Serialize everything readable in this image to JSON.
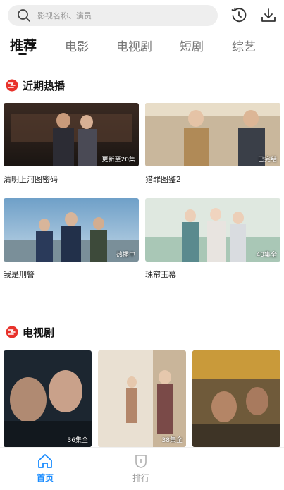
{
  "search": {
    "placeholder": "影视名称、演员",
    "icon": "search-icon"
  },
  "toolbar": {
    "history_icon": "history-icon",
    "download_icon": "download-icon"
  },
  "tabs": [
    {
      "label": "推荐",
      "active": true
    },
    {
      "label": "电影",
      "active": false
    },
    {
      "label": "电视剧",
      "active": false
    },
    {
      "label": "短剧",
      "active": false
    },
    {
      "label": "综艺",
      "active": false
    }
  ],
  "sections": {
    "recent": {
      "title": "近期热播",
      "items": [
        {
          "title": "清明上河图密码",
          "status": "更新至20集"
        },
        {
          "title": "猎罪图鉴2",
          "status": "已完结"
        },
        {
          "title": "我是刑警",
          "status": "热播中"
        },
        {
          "title": "珠帘玉幕",
          "status": "40集全"
        }
      ]
    },
    "tv": {
      "title": "电视剧",
      "items": [
        {
          "status": "36集全"
        },
        {
          "status": "38集全"
        },
        {
          "status": ""
        }
      ]
    }
  },
  "bottom_nav": {
    "home_label": "首页",
    "rank_label": "排行"
  },
  "colors": {
    "accent": "#1a8cff",
    "badge_red": "#e8322b",
    "inactive": "#9a9a9a"
  }
}
